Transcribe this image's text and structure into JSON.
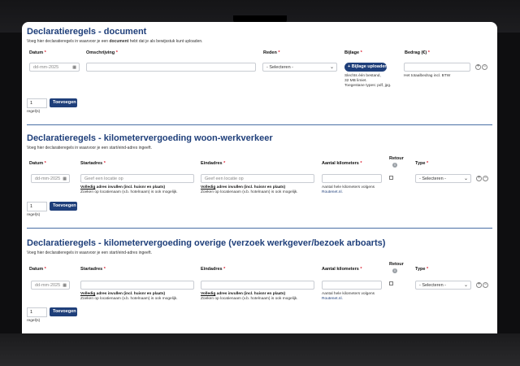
{
  "sections": [
    {
      "title": "Declaratieregels - document",
      "subtitle_pre": "Voeg hier declaratieregels in waarvoor je een ",
      "subtitle_bold": "document",
      "subtitle_post": " hebt dat je als bewijsstuk kunt uploaden.",
      "labels": {
        "datum": "Datum",
        "omschrijving": "Omschrijving",
        "reden": "Reden",
        "bijlage": "Bijlage",
        "bedrag": "Bedrag (€)"
      },
      "date_placeholder": "dd-mm-2025",
      "reden_select": "- Selecteren -",
      "upload_button": "+ Bijlage uploaden",
      "upload_notes": [
        "Slechts één bestand,",
        "32 MB limiet.",
        "Toegestane types: pdf, jpg."
      ],
      "bedrag_note": "Het totaalbedrag incl. BTW",
      "qty": "1",
      "add_button": "Toevoegen",
      "regels": "regel(s)"
    },
    {
      "title": "Declaratieregels - kilometervergoeding woon-werkverkeer",
      "subtitle": "Voeg hier declaratieregels in waarvoor je een start/eind-adres ingeeft.",
      "labels": {
        "datum": "Datum",
        "startadres": "Startadres",
        "eindadres": "Eindadres",
        "km": "Aantal kilometers",
        "retour": "Retour",
        "type": "Type"
      },
      "date_placeholder": "dd-mm-2025",
      "start_placeholder": "Geef een locatie op",
      "eind_placeholder": "Geef een locatie op",
      "hint_bold": "Volledig",
      "hint_mid": " adres invullen ",
      "hint_bold2": "(incl. huisnr en plaats)",
      "hint2": "Zoeken op locatienaam (v.b. hotelnaam) is ook mogelijk.",
      "km_hint": "Aantal hele kilometers volgens",
      "km_link": "Routenet.nl.",
      "type_select": "- Selecteren -",
      "qty": "1",
      "add_button": "Toevoegen",
      "regels": "regel(s)"
    },
    {
      "title": "Declaratieregels - kilometervergoeding overige (verzoek werkgever/bezoek arboarts)",
      "subtitle": "Voeg hier declaratieregels in waarvoor je een start/eind-adres ingeeft.",
      "labels": {
        "datum": "Datum",
        "startadres": "Startadres",
        "eindadres": "Eindadres",
        "km": "Aantal kilometers",
        "retour": "Retour",
        "type": "Type"
      },
      "date_placeholder": "dd-mm-2025",
      "hint_bold": "Volledig",
      "hint_mid": " adres invullen ",
      "hint_bold2": "(incl. huisnr en plaats)",
      "hint2": "Zoeken op locatienaam (v.b. hotelnaam) is ook mogelijk.",
      "km_hint": "Aantal hele kilometers volgens",
      "km_link": "Routenet.nl.",
      "type_select": "- Selecteren -",
      "qty": "1",
      "add_button": "Toevoegen",
      "regels": "regel(s)"
    }
  ],
  "colors": {
    "accent": "#1f3f7a",
    "required": "#d23",
    "divider": "#4a6fa5"
  },
  "icons": [
    "calendar-icon",
    "chevron-down-icon",
    "add-row-icon",
    "remove-row-icon",
    "info-icon"
  ]
}
